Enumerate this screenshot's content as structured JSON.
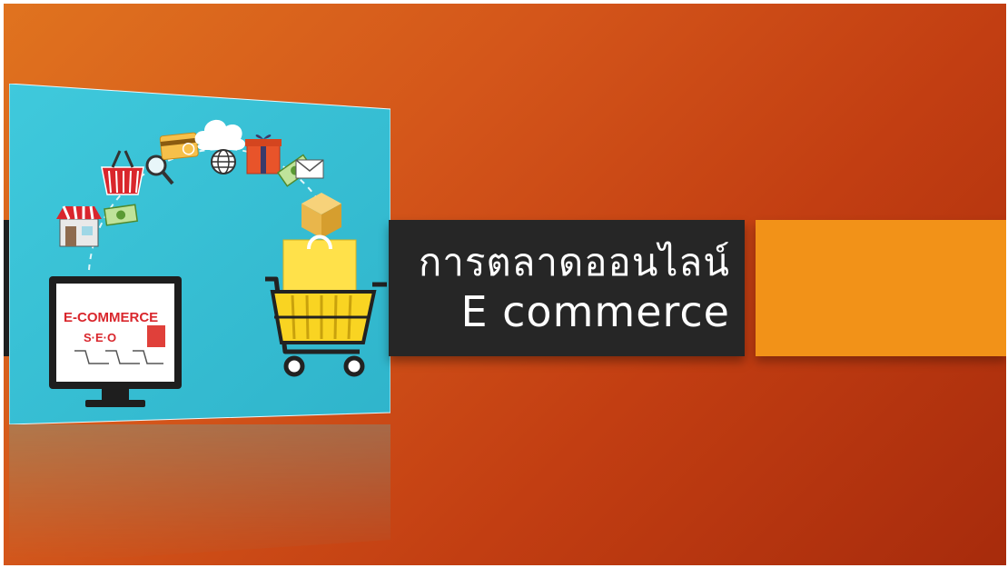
{
  "slide": {
    "title_line1": "การตลาดออนไลน์",
    "title_line2": "E commerce"
  },
  "illustration": {
    "monitor_text": "E-COMMERCE",
    "seo_text": "S·E·O"
  },
  "colors": {
    "background_start": "#e0731f",
    "background_end": "#a72b0c",
    "title_box": "#262626",
    "accent_box": "#f29218",
    "illustration_bg": "#33bdd3"
  },
  "icons": [
    "shop-icon",
    "money-icon",
    "basket-icon",
    "magnifier-icon",
    "credit-card-icon",
    "cloud-icon",
    "globe-icon",
    "gift-icon",
    "envelope-icon",
    "box-icon",
    "shopping-bag-icon",
    "shopping-cart-icon",
    "monitor-icon"
  ]
}
